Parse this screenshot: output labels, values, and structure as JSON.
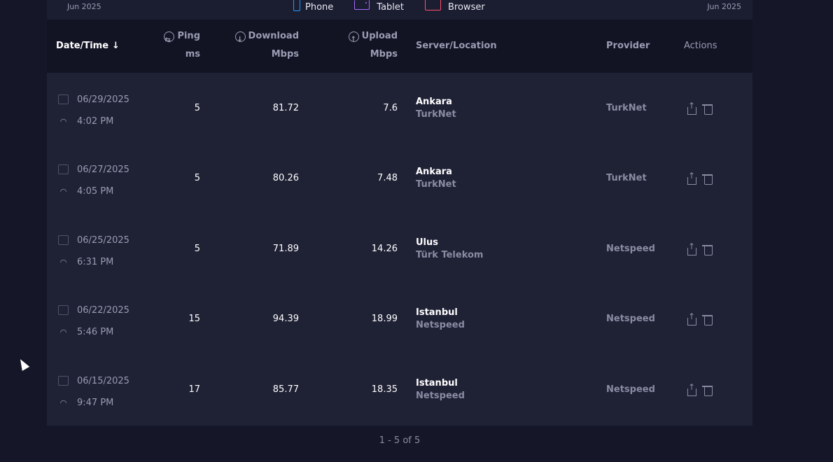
{
  "topbar": {
    "date_left": "Jun 2025",
    "date_right": "Jun 2025",
    "legend": [
      {
        "label": "Phone",
        "color": "#1e9bff"
      },
      {
        "label": "Tablet",
        "color": "#a86bff"
      },
      {
        "label": "Browser",
        "color": "#ff4f6d"
      }
    ]
  },
  "table": {
    "headers": {
      "date": "Date/Time",
      "ping_top": "Ping",
      "ping_unit": "ms",
      "download_top": "Download",
      "download_unit": "Mbps",
      "upload_top": "Upload",
      "upload_unit": "Mbps",
      "server": "Server/Location",
      "provider": "Provider",
      "actions": "Actions"
    },
    "rows": [
      {
        "date": "06/29/2025",
        "time": "4:02 PM",
        "ping": "5",
        "download": "81.72",
        "upload": "7.6",
        "city": "Ankara",
        "isp": "TurkNet",
        "provider": "TurkNet"
      },
      {
        "date": "06/27/2025",
        "time": "4:05 PM",
        "ping": "5",
        "download": "80.26",
        "upload": "7.48",
        "city": "Ankara",
        "isp": "TurkNet",
        "provider": "TurkNet"
      },
      {
        "date": "06/25/2025",
        "time": "6:31 PM",
        "ping": "5",
        "download": "71.89",
        "upload": "14.26",
        "city": "Ulus",
        "isp": "Türk Telekom",
        "provider": "Netspeed"
      },
      {
        "date": "06/22/2025",
        "time": "5:46 PM",
        "ping": "15",
        "download": "94.39",
        "upload": "18.99",
        "city": "Istanbul",
        "isp": "Netspeed",
        "provider": "Netspeed"
      },
      {
        "date": "06/15/2025",
        "time": "9:47 PM",
        "ping": "17",
        "download": "85.77",
        "upload": "18.35",
        "city": "Istanbul",
        "isp": "Netspeed",
        "provider": "Netspeed"
      }
    ]
  },
  "pagination": {
    "text": "1 - 5 of 5"
  }
}
